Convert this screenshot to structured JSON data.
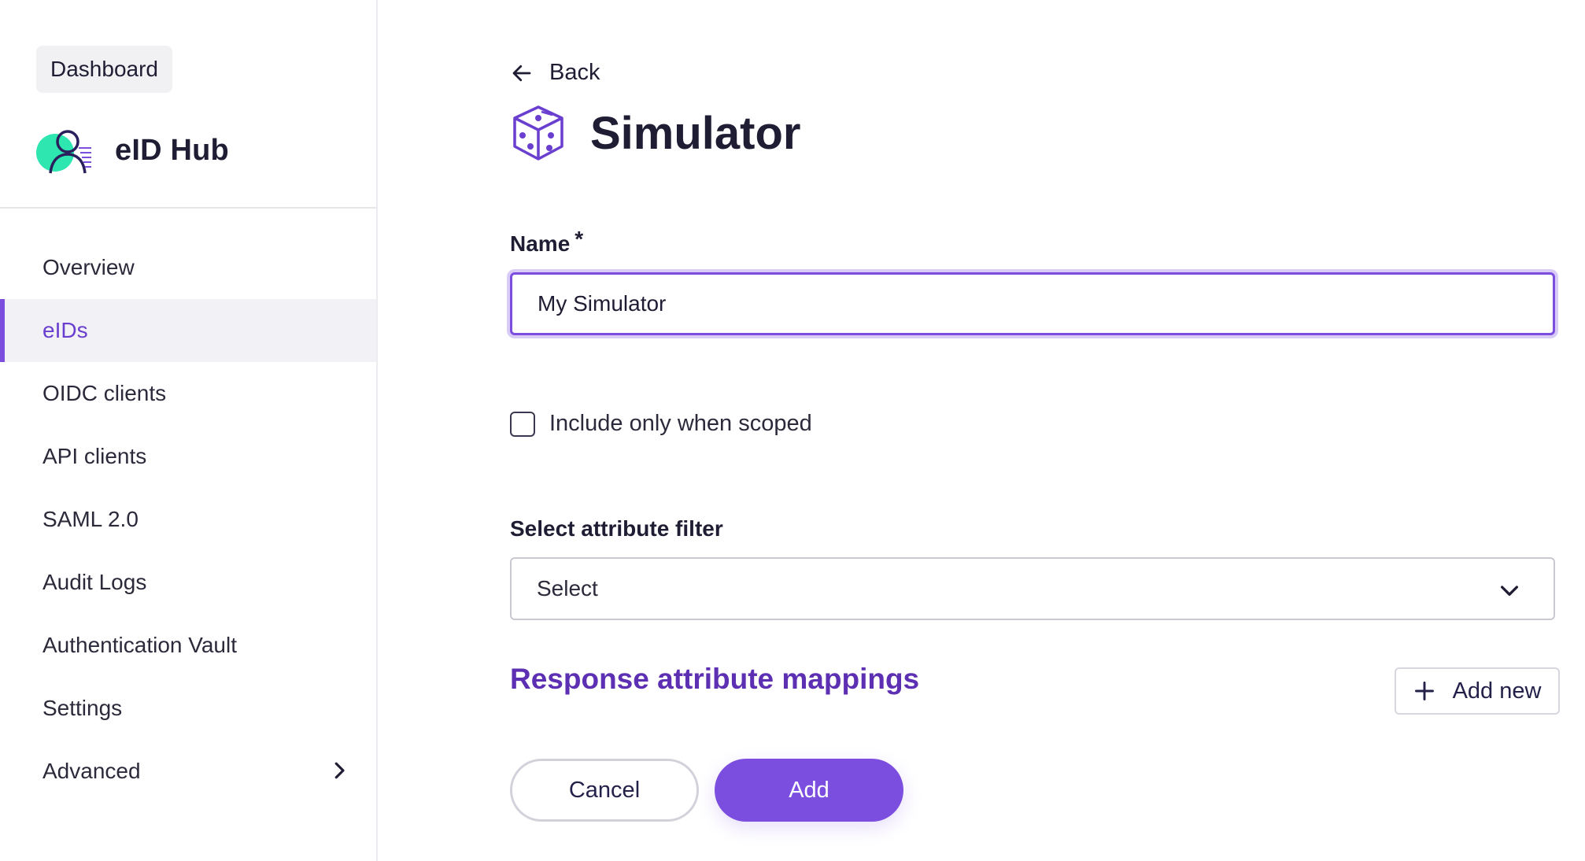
{
  "sidebar": {
    "dashboard_label": "Dashboard",
    "brand_name": "eID Hub",
    "items": [
      {
        "label": "Overview",
        "active": false
      },
      {
        "label": "eIDs",
        "active": true
      },
      {
        "label": "OIDC clients",
        "active": false
      },
      {
        "label": "API clients",
        "active": false
      },
      {
        "label": "SAML 2.0",
        "active": false
      },
      {
        "label": "Audit Logs",
        "active": false
      },
      {
        "label": "Authentication Vault",
        "active": false
      },
      {
        "label": "Settings",
        "active": false
      },
      {
        "label": "Advanced",
        "active": false,
        "has_submenu": true
      }
    ]
  },
  "main": {
    "back_label": "Back",
    "title": "Simulator",
    "title_icon": "dice-icon",
    "name_label": "Name",
    "name_required_mark": "*",
    "name_value": "My Simulator",
    "checkbox_label": "Include only when scoped",
    "checkbox_checked": false,
    "filter_label": "Select attribute filter",
    "filter_value": "Select",
    "section_title": "Response attribute mappings",
    "add_new_label": "Add new",
    "cancel_label": "Cancel",
    "add_label": "Add"
  },
  "colors": {
    "accent": "#7b4ee0",
    "section_title": "#5d2fb3",
    "brand_teal": "#2ee6b0",
    "text": "#1f1d33"
  }
}
